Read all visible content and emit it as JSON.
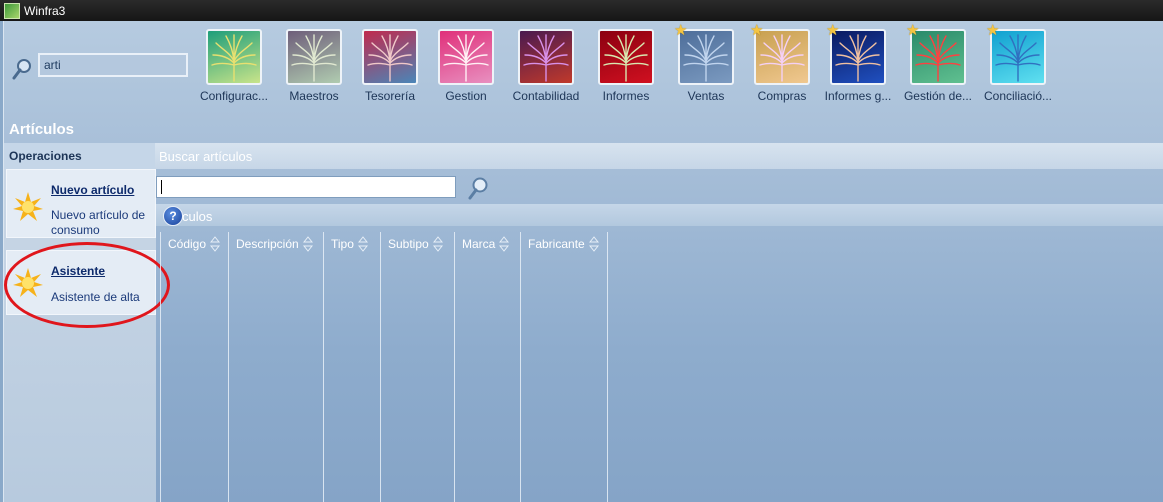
{
  "window": {
    "title": "Winfra3"
  },
  "top_search": {
    "value": "arti"
  },
  "modules": [
    {
      "label": "Configurac...",
      "starred": false,
      "colors": [
        "#1e9e7a",
        "#c9e48a",
        "#e8e070"
      ]
    },
    {
      "label": "Maestros",
      "starred": false,
      "colors": [
        "#6e5e7a",
        "#b0ccb0",
        "#e0e8d0"
      ]
    },
    {
      "label": "Tesorería",
      "starred": false,
      "colors": [
        "#c02a4e",
        "#4a86b8",
        "#f0c8c8"
      ]
    },
    {
      "label": "Gestion",
      "starred": false,
      "colors": [
        "#e0307a",
        "#e890c0",
        "#fff0f4"
      ]
    },
    {
      "label": "Contabilidad",
      "starred": false,
      "colors": [
        "#4a1a50",
        "#c0392b",
        "#d890e8"
      ]
    },
    {
      "label": "Informes",
      "starred": false,
      "colors": [
        "#8b0010",
        "#d01020",
        "#d8e8b0"
      ]
    },
    {
      "label": "Ventas",
      "starred": true,
      "colors": [
        "#4e6e9a",
        "#7b9ac0",
        "#c0d4ee"
      ]
    },
    {
      "label": "Compras",
      "starred": true,
      "colors": [
        "#c8a050",
        "#f0c890",
        "#f4d0f4"
      ]
    },
    {
      "label": "Informes g...",
      "starred": true,
      "colors": [
        "#0a1a60",
        "#2050c0",
        "#f0c0a0"
      ]
    },
    {
      "label": "Gestión de...",
      "starred": true,
      "colors": [
        "#2a8a6a",
        "#60c090",
        "#ff4040"
      ]
    },
    {
      "label": "Conciliació...",
      "starred": true,
      "colors": [
        "#10a0d0",
        "#60e0f0",
        "#3070c0"
      ]
    }
  ],
  "page": {
    "title": "Artículos"
  },
  "sidebar": {
    "header": "Operaciones",
    "operations": [
      {
        "title": "Nuevo artículo",
        "desc": "Nuevo artículo de consumo"
      },
      {
        "title": "Asistente",
        "desc": "Asistente de alta"
      }
    ]
  },
  "search": {
    "title": "Buscar artículos",
    "value": ""
  },
  "results": {
    "title": "culos",
    "help_icon": "question-icon",
    "columns": [
      "Código",
      "Descripción",
      "Tipo",
      "Subtipo",
      "Marca",
      "Fabricante"
    ]
  }
}
